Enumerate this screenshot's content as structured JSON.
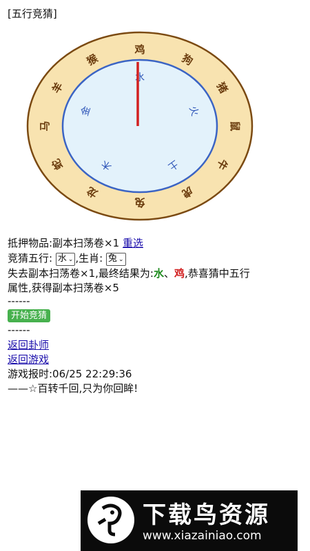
{
  "page_title": "[五行竞猜]",
  "wheel": {
    "zodiac": [
      "鸡",
      "狗",
      "猪",
      "鼠",
      "牛",
      "虎",
      "兔",
      "龙",
      "蛇",
      "马",
      "羊",
      "猴"
    ],
    "elements": [
      "水",
      "火",
      "土",
      "木",
      "金"
    ]
  },
  "bet": {
    "prefix": "抵押物品:副本扫荡卷×1",
    "reselect": "重选"
  },
  "guess": {
    "element_label": "竞猜五行:",
    "element_value": "水",
    "zodiac_label": ",生肖:",
    "zodiac_value": "兔"
  },
  "result": {
    "line1_prefix": "失去副本扫荡卷×1,最终结果为:",
    "element": "水",
    "sep": "、",
    "zodiac": "鸡",
    "line1_suffix": ",恭喜猜中五行",
    "line2": "属性,获得副本扫荡卷×5"
  },
  "divider1": "------",
  "start_button": "开始竞猜",
  "divider2": "------",
  "links": {
    "back_master": "返回卦师",
    "back_game": "返回游戏"
  },
  "clock": "游戏报时:06/25 22:29:36",
  "motto": "——☆百转千回,只为你回眸!",
  "banner": {
    "title": "下载鸟资源",
    "url": "www.xiazainiao.com"
  },
  "colors": {
    "outer_ring": "#f8e3b0",
    "ring_border": "#7b4a12",
    "inner_disc": "#e3f2fb",
    "inner_border": "#3b64c4",
    "zodiac_text": "#6b3c0e",
    "element_text": "#2f56b8",
    "needle": "#d22020"
  }
}
